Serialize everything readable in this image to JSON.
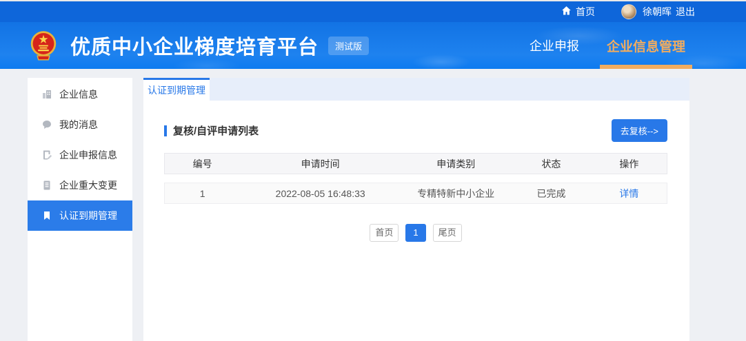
{
  "topbar": {
    "home": "首页",
    "username": "徐朝晖",
    "logout": "退出"
  },
  "header": {
    "title": "优质中小企业梯度培育平台",
    "badge": "测试版",
    "nav": [
      {
        "label": "企业申报",
        "active": false
      },
      {
        "label": "企业信息管理",
        "active": true
      }
    ]
  },
  "sidebar": {
    "items": [
      {
        "label": "企业信息",
        "icon": "building-icon",
        "active": false
      },
      {
        "label": "我的消息",
        "icon": "message-icon",
        "active": false
      },
      {
        "label": "企业申报信息",
        "icon": "declare-doc-icon",
        "active": false
      },
      {
        "label": "企业重大变更",
        "icon": "change-doc-icon",
        "active": false
      },
      {
        "label": "认证到期管理",
        "icon": "bookmark-icon",
        "active": true
      }
    ]
  },
  "main": {
    "tab": {
      "label": "认证到期管理",
      "active": true
    },
    "section": {
      "title": "复核/自评申请列表",
      "action_button": "去复核-->"
    },
    "table": {
      "columns": [
        "编号",
        "申请时间",
        "申请类别",
        "状态",
        "操作"
      ],
      "rows": [
        {
          "no": "1",
          "apply_time": "2022-08-05 16:48:33",
          "category": "专精特新中小企业",
          "status": "已完成",
          "action": "详情"
        }
      ]
    },
    "pagination": {
      "first": "首页",
      "current_page": "1",
      "last": "尾页"
    }
  },
  "colors": {
    "topbar_blue": "#0e66da",
    "header_blue": "#1273e4",
    "accent_blue": "#2878e8",
    "sidebar_active_blue": "#2b7ce9",
    "nav_active_orange": "#f0ac60",
    "page_bg": "#eef0f4",
    "tabstrip_bg": "#e7eefa",
    "table_header_bg": "#f6f6f8",
    "row_bg": "#fafafa"
  }
}
